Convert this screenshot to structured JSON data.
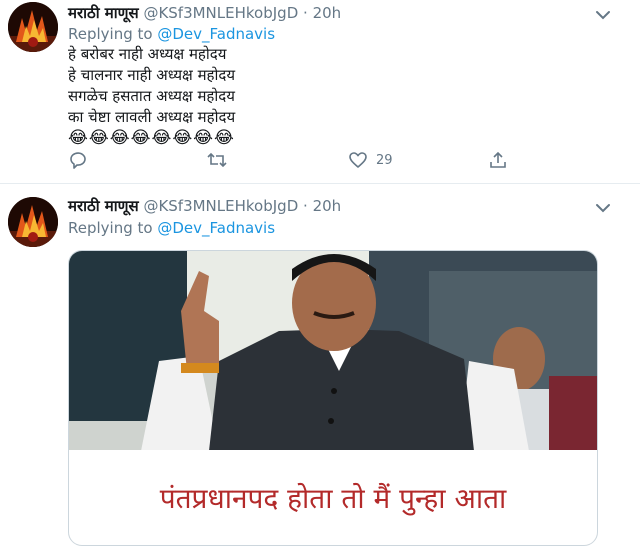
{
  "tweets": [
    {
      "display_name": "मराठी माणूस",
      "handle": "@KSf3MNLEHkobJgD",
      "separator": "·",
      "time": "20h",
      "replying_label": "Replying to",
      "replying_handle": "@Dev_Fadnavis",
      "lines": [
        "हे बरोबर नाही अध्यक्ष महोदय",
        "हे चालनार नाही अध्यक्ष महोदय",
        "सगळेच हसतात अध्यक्ष महोदय",
        "का चेष्टा लावली अध्यक्ष महोदय"
      ],
      "emojis": "😂😂😂😂😂😂😂😂",
      "like_count": "29",
      "icons": [
        "reply-icon",
        "retweet-icon",
        "like-icon",
        "share-icon",
        "caret-down-icon"
      ]
    },
    {
      "display_name": "मराठी माणूस",
      "handle": "@KSf3MNLEHkobJgD",
      "separator": "·",
      "time": "20h",
      "replying_label": "Replying to",
      "replying_handle": "@Dev_Fadnavis",
      "media_caption": "पंतप्रधानपद होता तो मैं पुन्हा आता"
    }
  ],
  "colors": {
    "link": "#1b95e0",
    "muted": "#657786",
    "text": "#14171a",
    "caption": "#b32a2a"
  }
}
